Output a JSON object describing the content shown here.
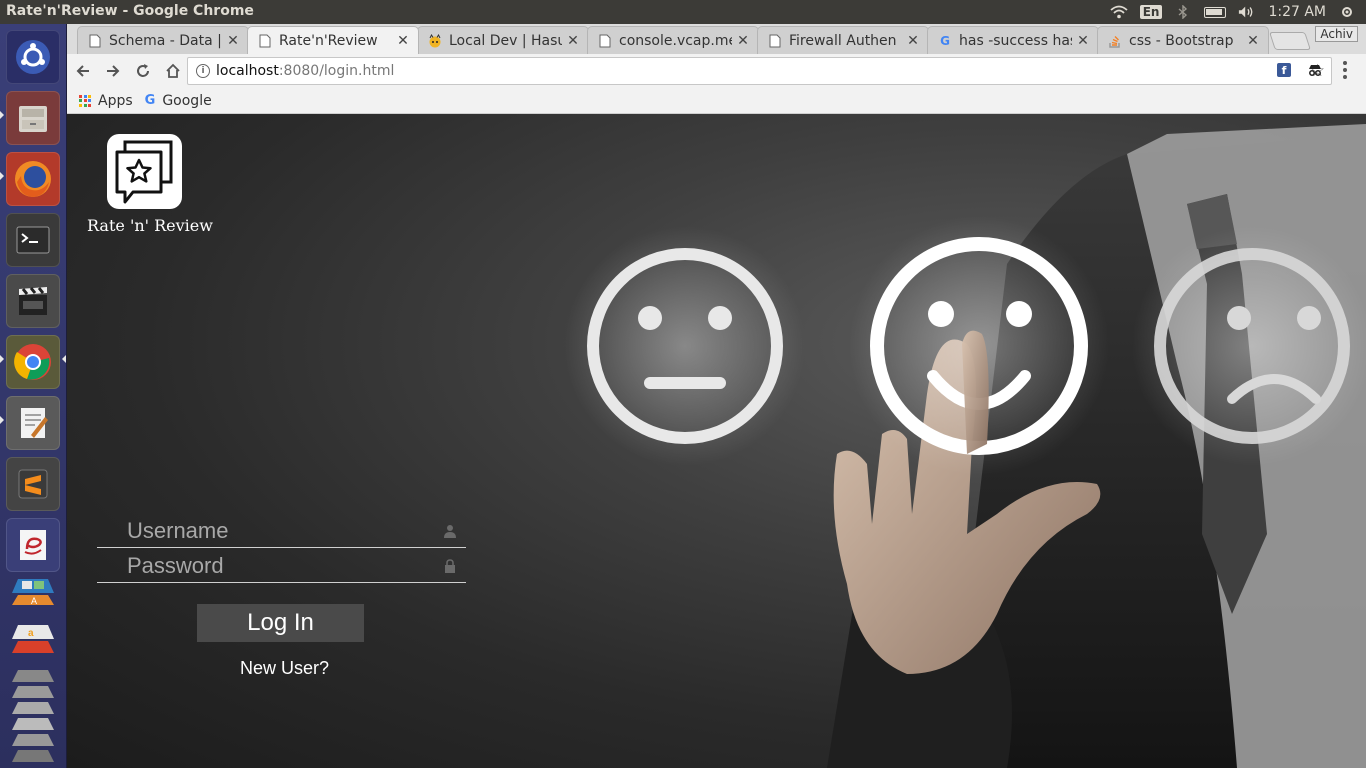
{
  "window": {
    "title": "Rate'n'Review - Google Chrome"
  },
  "tray": {
    "lang": "En",
    "time": "1:27 AM"
  },
  "tabs": [
    {
      "title": "Schema - Data | ",
      "icon": "page-icon"
    },
    {
      "title": "Rate'n'Review",
      "icon": "page-icon"
    },
    {
      "title": "Local Dev | Hasu",
      "icon": "hasura-icon"
    },
    {
      "title": "console.vcap.me",
      "icon": "page-icon"
    },
    {
      "title": "Firewall Authen",
      "icon": "page-icon"
    },
    {
      "title": "has -success has",
      "icon": "google-icon"
    },
    {
      "title": "css - Bootstrap",
      "icon": "stackoverflow-icon"
    }
  ],
  "profile": "Achiv",
  "url": {
    "host": "localhost",
    "rest": ":8080/login.html"
  },
  "bookmarks": {
    "apps": "Apps",
    "google": "Google"
  },
  "brand": {
    "name": "Rate 'n' Review"
  },
  "login": {
    "username_placeholder": "Username",
    "password_placeholder": "Password",
    "button": "Log In",
    "new_user": "New User?"
  },
  "colors": {
    "launcher": "#3a3f78",
    "panel": "#3c3b37",
    "button": "#4a4a4a"
  }
}
